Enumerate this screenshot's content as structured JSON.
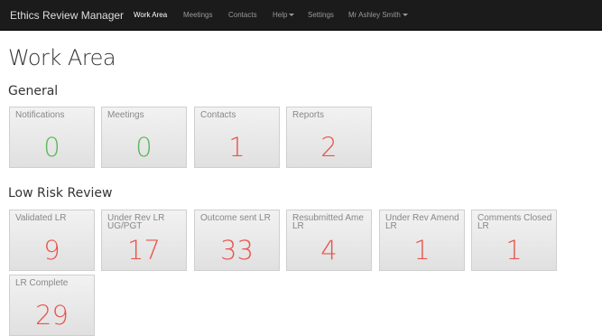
{
  "navbar": {
    "brand": "Ethics Review Manager",
    "items": [
      {
        "label": "Work Area",
        "active": true,
        "dropdown": false
      },
      {
        "label": "Meetings",
        "active": false,
        "dropdown": false
      },
      {
        "label": "Contacts",
        "active": false,
        "dropdown": false
      },
      {
        "label": "Help",
        "active": false,
        "dropdown": true
      },
      {
        "label": "Settings",
        "active": false,
        "dropdown": false
      },
      {
        "label": "Mr Ashley Smith",
        "active": false,
        "dropdown": true
      }
    ]
  },
  "page_title": "Work Area",
  "sections": [
    {
      "title": "General",
      "tiles": [
        {
          "label": "Notifications",
          "value": "0",
          "color": "#5cb85c"
        },
        {
          "label": "Meetings",
          "value": "0",
          "color": "#5cb85c"
        },
        {
          "label": "Contacts",
          "value": "1",
          "color": "#e8554e"
        },
        {
          "label": "Reports",
          "value": "2",
          "color": "#e8554e"
        }
      ]
    },
    {
      "title": "Low Risk Review",
      "tiles": [
        {
          "label": "Validated LR",
          "value": "9",
          "color": "#e8554e"
        },
        {
          "label": "Under Rev LR UG/PGT",
          "value": "17",
          "color": "#e8554e"
        },
        {
          "label": "Outcome sent LR",
          "value": "33",
          "color": "#e8554e"
        },
        {
          "label": "Resubmitted Ame LR",
          "value": "4",
          "color": "#e8554e"
        },
        {
          "label": "Under Rev Amend LR",
          "value": "1",
          "color": "#e8554e"
        },
        {
          "label": "Comments Closed LR",
          "value": "1",
          "color": "#e8554e"
        },
        {
          "label": "LR Complete",
          "value": "29",
          "color": "#e8554e"
        }
      ]
    }
  ]
}
